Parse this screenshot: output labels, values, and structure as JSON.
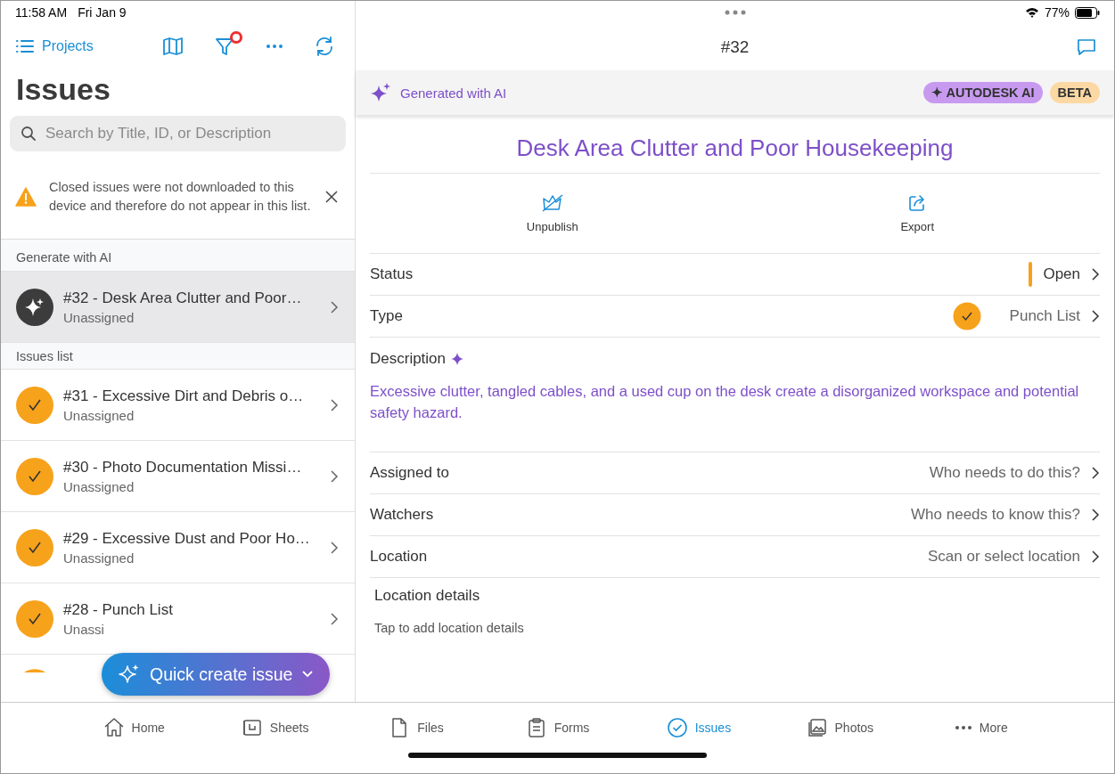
{
  "status_bar": {
    "time": "11:58 AM",
    "date": "Fri Jan 9",
    "battery": "77%"
  },
  "sidebar": {
    "projects_link": "Projects",
    "filter_active": true,
    "title": "Issues",
    "search": {
      "placeholder": "Search by Title, ID, or Description"
    },
    "notice": "Closed issues were not downloaded to this device and therefore do not appear in this list.",
    "sections": [
      {
        "heading": "Generate with AI",
        "items": [
          {
            "kind": "ai",
            "title": "#32  -  Desk Area Clutter and Poor…",
            "subtitle": "Unassigned",
            "selected": true
          }
        ]
      },
      {
        "heading": "Issues list",
        "items": [
          {
            "kind": "punch",
            "title": "#31  -  Excessive Dirt and Debris o…",
            "subtitle": "Unassigned",
            "selected": false
          },
          {
            "kind": "punch",
            "title": "#30  -  Photo Documentation Missi…",
            "subtitle": "Unassigned",
            "selected": false
          },
          {
            "kind": "punch",
            "title": "#29  -  Excessive Dust and Poor Ho…",
            "subtitle": "Unassigned",
            "selected": false
          },
          {
            "kind": "punch",
            "title": "#28  -  Punch List",
            "subtitle": "Unassi",
            "selected": false
          }
        ]
      }
    ],
    "quick_create": "Quick create issue"
  },
  "detail": {
    "header": "#32",
    "ai_banner": {
      "label": "Generated with AI",
      "badges": [
        "✦ AUTODESK AI",
        "BETA"
      ]
    },
    "title": "Desk Area Clutter and Poor Housekeeping",
    "actions": [
      {
        "kind": "unpublish",
        "label": "Unpublish"
      },
      {
        "kind": "export",
        "label": "Export"
      }
    ],
    "fields": [
      {
        "kind": "status",
        "label": "Status",
        "value": "Open"
      },
      {
        "kind": "type",
        "label": "Type",
        "value": "Punch List"
      },
      {
        "kind": "description",
        "label": "Description",
        "value": "Excessive clutter, tangled cables, and a used cup on the desk create a disorganized workspace and potential safety hazard."
      },
      {
        "kind": "link",
        "label": "Assigned to",
        "value": "Who needs to do this?"
      },
      {
        "kind": "link",
        "label": "Watchers",
        "value": "Who needs to know this?"
      },
      {
        "kind": "link",
        "label": "Location",
        "value": "Scan or select location"
      },
      {
        "kind": "note",
        "label": "Location details",
        "value": "Tap to add location details"
      }
    ]
  },
  "tabs": [
    {
      "label": "Home",
      "kind": "home",
      "selected": false
    },
    {
      "label": "Sheets",
      "kind": "sheets",
      "selected": false
    },
    {
      "label": "Files",
      "kind": "files",
      "selected": false
    },
    {
      "label": "Forms",
      "kind": "forms",
      "selected": false
    },
    {
      "label": "Issues",
      "kind": "issues",
      "selected": true
    },
    {
      "label": "Photos",
      "kind": "photos",
      "selected": false
    },
    {
      "label": "More",
      "kind": "more",
      "selected": false
    }
  ]
}
